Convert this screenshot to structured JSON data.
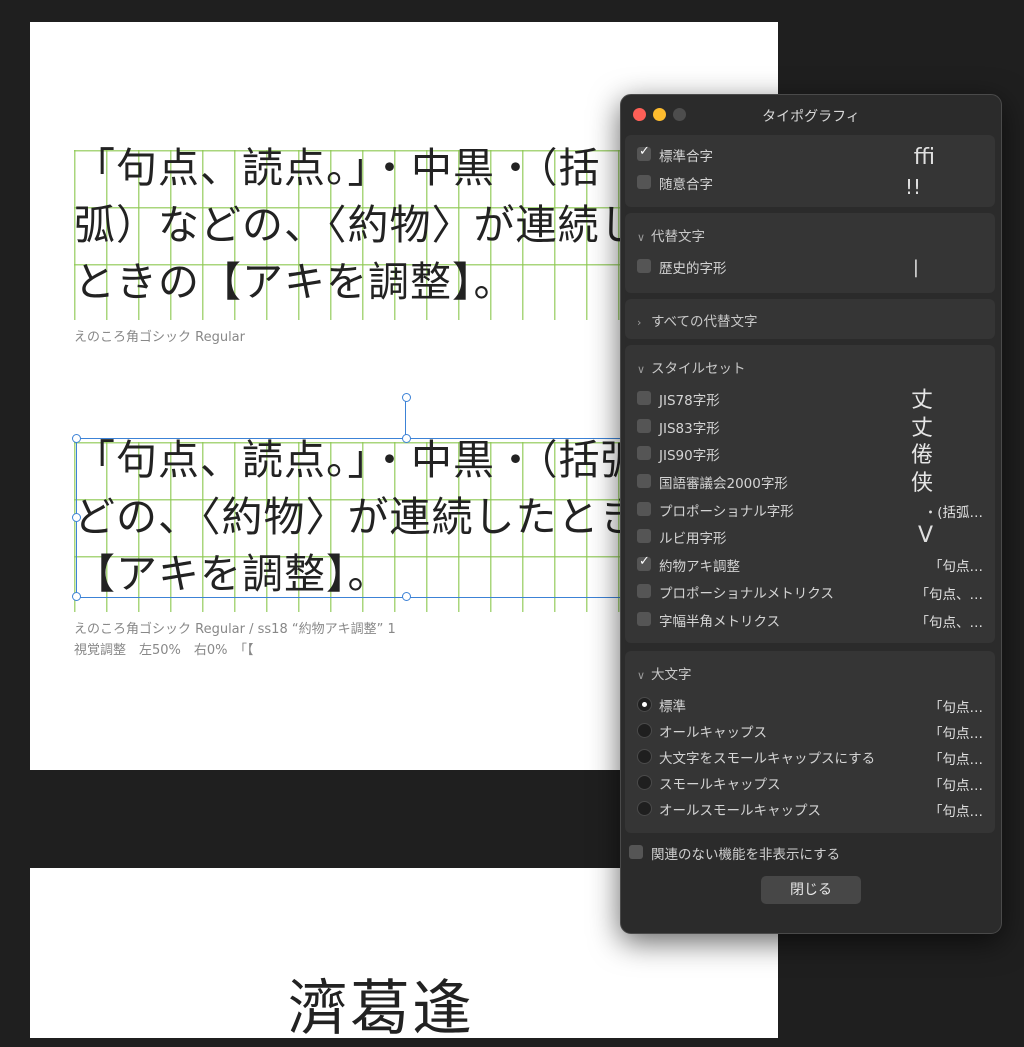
{
  "canvas": {
    "sample1": [
      "「句点、読点。」・中黒・（括",
      "弧）などの、〈約物〉が連続した",
      "ときの【アキを調整】。"
    ],
    "caption1": "えのころ角ゴシック Regular",
    "sample2": [
      "「句点、読点。」・中黒・（括弧）な",
      "どの、〈約物〉が連続したとき",
      "【アキを調整】。"
    ],
    "caption2": [
      "えのころ角ゴシック Regular / ss18 “約物アキ調整” 1",
      "視覚調整　左50%　右0%　「【"
    ],
    "page2_text": "濟葛逢"
  },
  "dialog": {
    "title": "タイポグラフィ",
    "ligatures": {
      "items": [
        {
          "label": "標準合字",
          "checked": true,
          "preview": "ﬃ"
        },
        {
          "label": "随意合字",
          "checked": false,
          "preview": "!!"
        }
      ]
    },
    "alternates": {
      "header": "代替文字",
      "items": [
        {
          "label": "歴史的字形",
          "checked": false,
          "preview": "|"
        }
      ]
    },
    "all_alternates": {
      "header": "すべての代替文字"
    },
    "stylesets": {
      "header": "スタイルセット",
      "items": [
        {
          "label": "JIS78字形",
          "checked": false
        },
        {
          "label": "JIS83字形",
          "checked": false
        },
        {
          "label": "JIS90字形",
          "checked": false
        },
        {
          "label": "国語審議会2000字形",
          "checked": false
        },
        {
          "label": "プロポーショナル字形",
          "checked": false,
          "preview": "・(括弧…"
        },
        {
          "label": "ルビ用字形",
          "checked": false,
          "preview": "V"
        },
        {
          "label": "約物アキ調整",
          "checked": true,
          "preview": "「句点…"
        },
        {
          "label": "プロポーショナルメトリクス",
          "checked": false,
          "preview": "「句点、…"
        },
        {
          "label": "字幅半角メトリクス",
          "checked": false,
          "preview": "「句点、…"
        }
      ],
      "glyphs": [
        "丈",
        "丈",
        "倦",
        "侠"
      ]
    },
    "capitals": {
      "header": "大文字",
      "items": [
        {
          "label": "標準",
          "selected": true,
          "preview": "「句点…"
        },
        {
          "label": "オールキャップス",
          "selected": false,
          "preview": "「句点…"
        },
        {
          "label": "大文字をスモールキャップスにする",
          "selected": false,
          "preview": "「句点…"
        },
        {
          "label": "スモールキャップス",
          "selected": false,
          "preview": "「句点…"
        },
        {
          "label": "オールスモールキャップス",
          "selected": false,
          "preview": "「句点…"
        }
      ]
    },
    "hide_unrelated": {
      "label": "関連のない機能を非表示にする",
      "checked": false
    },
    "close_label": "閉じる"
  }
}
